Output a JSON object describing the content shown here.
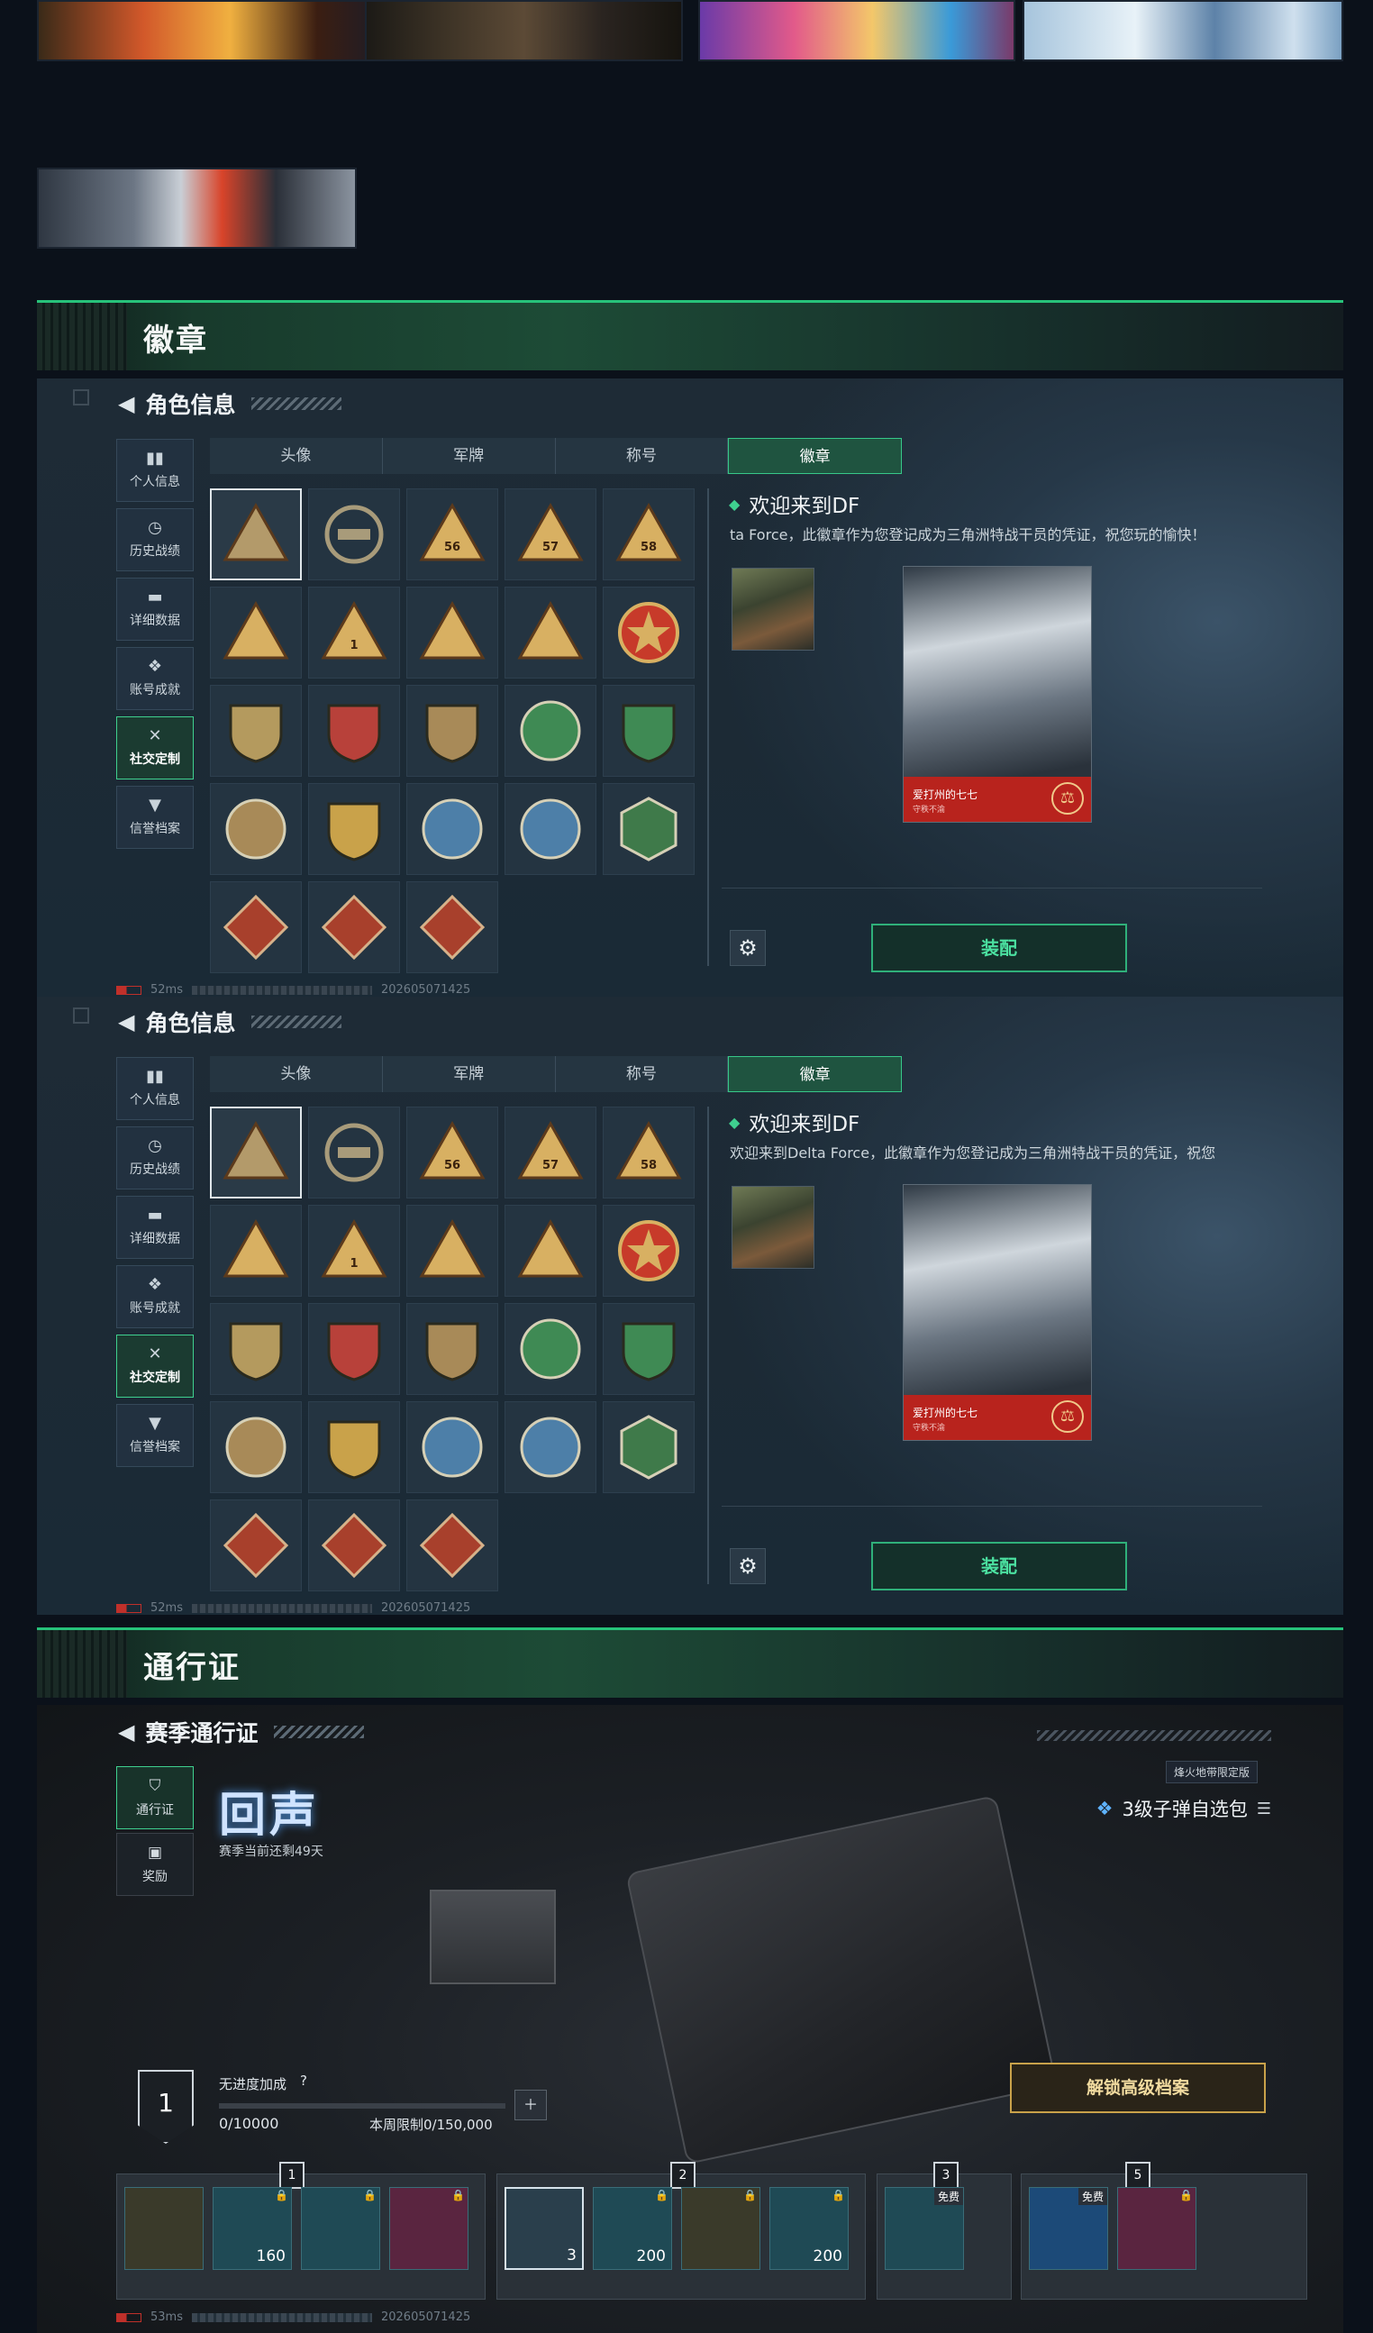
{
  "sections": {
    "badge_title": "徽章",
    "pass_title": "通行证"
  },
  "role_panel": {
    "header": "角色信息",
    "sidebar": [
      {
        "label": "个人信息",
        "icon": "bar-chart-icon"
      },
      {
        "label": "历史战绩",
        "icon": "clock-icon"
      },
      {
        "label": "详细数据",
        "icon": "folder-icon"
      },
      {
        "label": "账号成就",
        "icon": "medal-icon"
      },
      {
        "label": "社交定制",
        "icon": "tools-icon"
      },
      {
        "label": "信誉档案",
        "icon": "shield-icon"
      }
    ],
    "tabs": [
      "头像",
      "军牌",
      "称号",
      "徽章"
    ],
    "active_tab": "徽章",
    "badge_name": "欢迎来到DF",
    "badge_desc_1": "ta Force，此徽章作为您登记成为三角洲特战干员的凭证，祝您玩的愉快！",
    "badge_desc_2": "欢迎来到Delta Force，此徽章作为您登记成为三角洲特战干员的凭证，祝您",
    "card_name": "爱打州的七七",
    "card_sub": "守秩不渝",
    "equip_label": "装配",
    "ping_1": "52ms",
    "ping_2": "52ms",
    "build_id": "202605071425",
    "badge_numbers": [
      "56",
      "57",
      "58",
      "1"
    ]
  },
  "pass_panel": {
    "header": "赛季通行证",
    "sidebar": [
      {
        "label": "通行证",
        "icon": "pass-icon"
      },
      {
        "label": "奖励",
        "icon": "gift-icon"
      }
    ],
    "logo_text": "回声",
    "season_remaining": "赛季当前还剩49天",
    "region_tag": "烽火地带限定版",
    "pack_label": "3级子弹自选包",
    "level": "1",
    "no_bonus": "无进度加成",
    "help": "?",
    "progress": "0/10000",
    "progress_fraction": 0,
    "weekly_limit": "本周限制0/150,000",
    "unlock_label": "解锁高级档案",
    "track_markers": [
      "1",
      "2",
      "3",
      "5"
    ],
    "reward_counts": [
      "160",
      "3",
      "200",
      "200"
    ],
    "free_label": "免费",
    "ping": "53ms",
    "build_id": "202605071425"
  }
}
